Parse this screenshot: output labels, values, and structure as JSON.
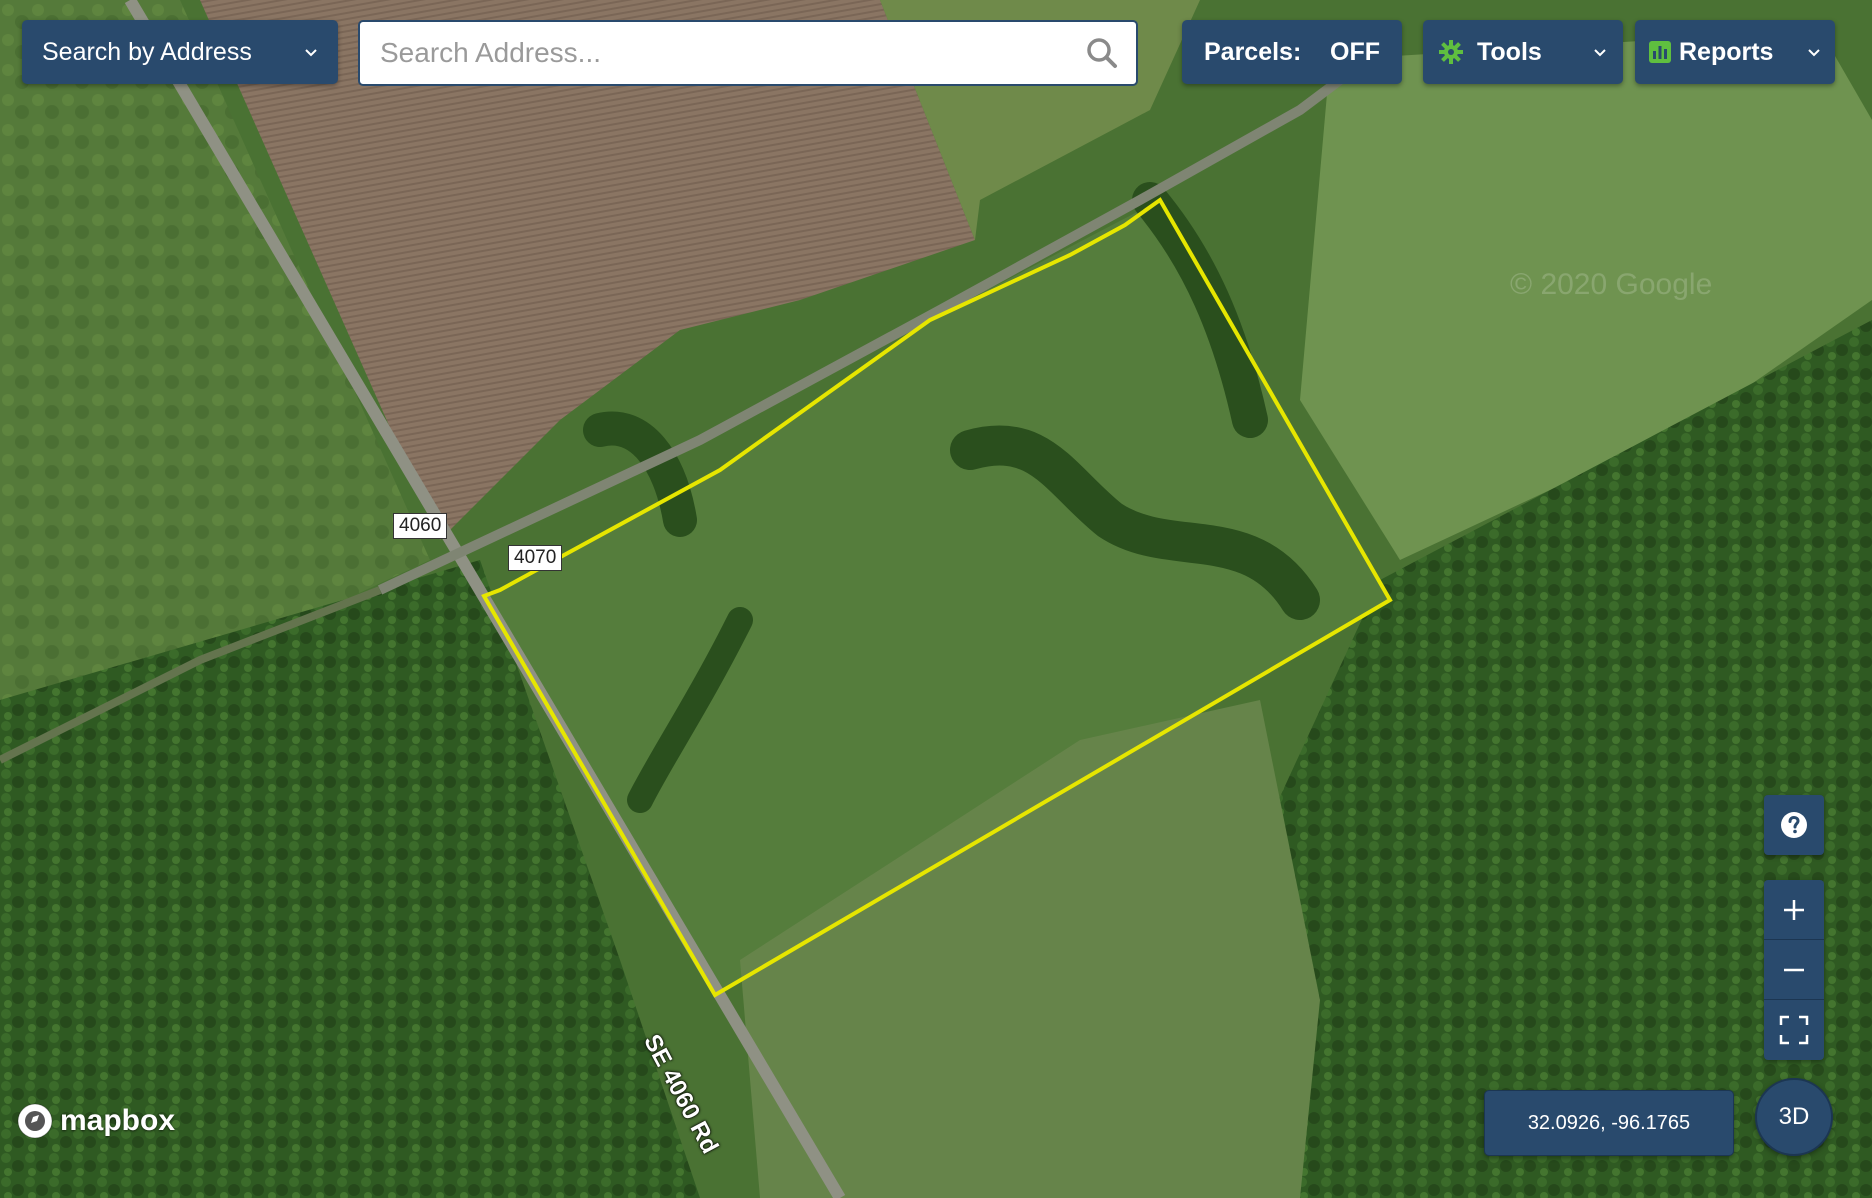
{
  "search": {
    "mode_label": "Search by Address",
    "placeholder": "Search Address..."
  },
  "parcels": {
    "label": "Parcels:",
    "state": "OFF"
  },
  "tools": {
    "label": "Tools"
  },
  "reports": {
    "label": "Reports"
  },
  "map": {
    "road_labels": {
      "county_road_a": "4060",
      "county_road_b": "4070",
      "road_name": "SE 4060 Rd"
    },
    "watermark": "© 2020 Google",
    "parcel_outline_color": "#e6e600",
    "coordinates": "32.0926, -96.1765",
    "logo_text": "mapbox"
  },
  "controls": {
    "three_d_label": "3D",
    "help_icon": "question-circle-icon",
    "zoom_in_icon": "plus-icon",
    "zoom_out_icon": "minus-icon",
    "fullscreen_icon": "fullscreen-icon"
  },
  "colors": {
    "panel": "#294a6d",
    "accent_green": "#5fbf3f"
  }
}
